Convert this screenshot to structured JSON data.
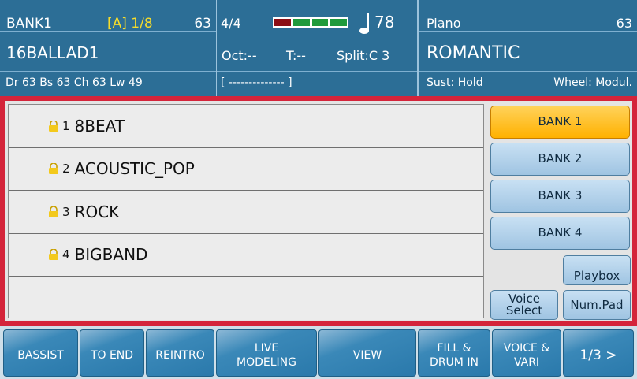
{
  "header": {
    "bank": "BANK1",
    "sequence": "[A] 1/8",
    "style_number": "63",
    "style_name": "16BALLAD1",
    "parts_volume": "Dr 63  Bs 63  Ch 63  Lw 49",
    "time_signature": "4/4",
    "tempo": "78",
    "octave": "Oct:--",
    "transpose": "T:--",
    "split": "Split:C 3",
    "lyric_field": "[ -------------- ]",
    "instrument": "Piano",
    "instrument_number": "63",
    "voice_name": "ROMANTIC",
    "sustain": "Sust: Hold",
    "wheel": "Wheel: Modul.",
    "meter_colors": [
      "#8b0f16",
      "#1f9a3c",
      "#1f9a3c",
      "#1f9a3c"
    ],
    "seq_color": "#f7dd2a"
  },
  "styles_list": [
    {
      "index": "1",
      "name": "8BEAT",
      "icon": "lock-icon"
    },
    {
      "index": "2",
      "name": "ACOUSTIC_POP",
      "icon": "lock-icon"
    },
    {
      "index": "3",
      "name": "ROCK",
      "icon": "lock-icon"
    },
    {
      "index": "4",
      "name": "BIGBAND",
      "icon": "lock-icon"
    },
    {
      "index": "",
      "name": "",
      "icon": ""
    }
  ],
  "side_buttons": {
    "bank1": "BANK 1",
    "bank2": "BANK 2",
    "bank3": "BANK 3",
    "bank4": "BANK 4",
    "playbox": "Playbox",
    "voice_select_1": "Voice",
    "voice_select_2": "Select",
    "num_pad": "Num.Pad",
    "active_color": "#ffb100"
  },
  "softkeys": {
    "bassist": "BASSIST",
    "to_end": "TO END",
    "reintro": "REINTRO",
    "live_1": "LIVE",
    "live_2": "MODELING",
    "view": "VIEW",
    "fill_1": "FILL &",
    "fill_2": "DRUM IN",
    "voice_1": "VOICE &",
    "voice_2": "VARI",
    "page": "1/3 >"
  },
  "colors": {
    "header_bg": "#2c6e96",
    "frame_red": "#d4243a"
  }
}
